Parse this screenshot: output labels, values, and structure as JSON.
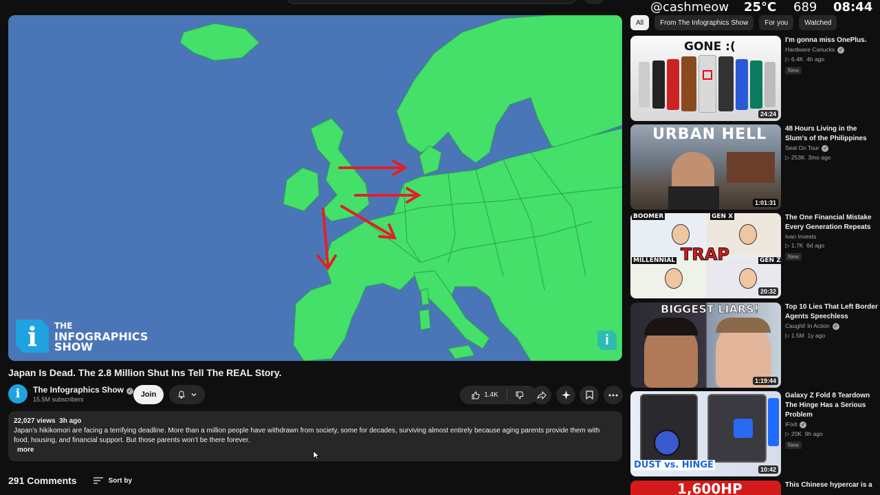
{
  "overlay": {
    "handle": "@cashmeow",
    "temp": "25°C",
    "count": "689",
    "clock": "08:44"
  },
  "player": {
    "logo_line1": "THE",
    "logo_line2": "INFOGRAPHICS",
    "logo_line3": "SHOW",
    "logo_letter": "i",
    "colors": {
      "sea": "#4a76b8",
      "land": "#44e06a",
      "arrow": "#e0202a"
    }
  },
  "video": {
    "title": "Japan Is Dead. The 2.8 Million Shut Ins Tell The REAL Story.",
    "channel": "The Infographics Show",
    "subscribers": "15.5M subscribers",
    "join_label": "Join",
    "likes": "1.4K",
    "views": "22,027 views",
    "age": "3h ago",
    "description": "Japan’s hikikomori are facing a terrifying deadline. More than a million people have withdrawn from society, some for decades, surviving almost entirely because aging parents provide them with food, housing, and financial support. But those parents won’t be there forever.",
    "more_label": "more"
  },
  "comments": {
    "count": "291 Comments",
    "sort_label": "Sort by"
  },
  "chips": [
    "All",
    "From The Infographics Show",
    "For you",
    "Watched"
  ],
  "recommendations": [
    {
      "title": "I'm gonna miss OnePlus.",
      "channel": "Hardware Canucks",
      "views": "6.4K",
      "age": "4h ago",
      "badge": "New",
      "duration": "24:24",
      "thumb_text": [
        "GONE :("
      ]
    },
    {
      "title": "48 Hours Living in the Slum's of the Philippines",
      "channel": "Seal On Tour",
      "views": "253K",
      "age": "3mo ago",
      "badge": "",
      "duration": "1:01:31",
      "thumb_text": [
        "URBAN HELL"
      ]
    },
    {
      "title": "The One Financial Mistake Every Generation Repeats",
      "channel": "Ivan Invests",
      "views": "1.7K",
      "age": "6d ago",
      "badge": "New",
      "duration": "20:32",
      "thumb_text": [
        "BOOMER",
        "GEN X",
        "TRAP",
        "MILLENNIAL",
        "GEN Z"
      ]
    },
    {
      "title": "Top 10 Lies That Left Border Agents Speechless",
      "channel": "Caught! In Action",
      "views": "1.5M",
      "age": "1y ago",
      "badge": "",
      "duration": "1:19:44",
      "thumb_text": [
        "BIGGEST LIARS!"
      ]
    },
    {
      "title": "Galaxy Z Fold 8 Teardown The Hinge Has a Serious Problem",
      "channel": "iFixit",
      "views": "20K",
      "age": "9h ago",
      "badge": "New",
      "duration": "10:42",
      "thumb_text": [
        "DUST vs. HINGE"
      ]
    },
    {
      "title": "This Chinese hypercar is a",
      "channel": "",
      "views": "",
      "age": "",
      "badge": "",
      "duration": "",
      "thumb_text": [
        "1,600HP"
      ]
    }
  ]
}
